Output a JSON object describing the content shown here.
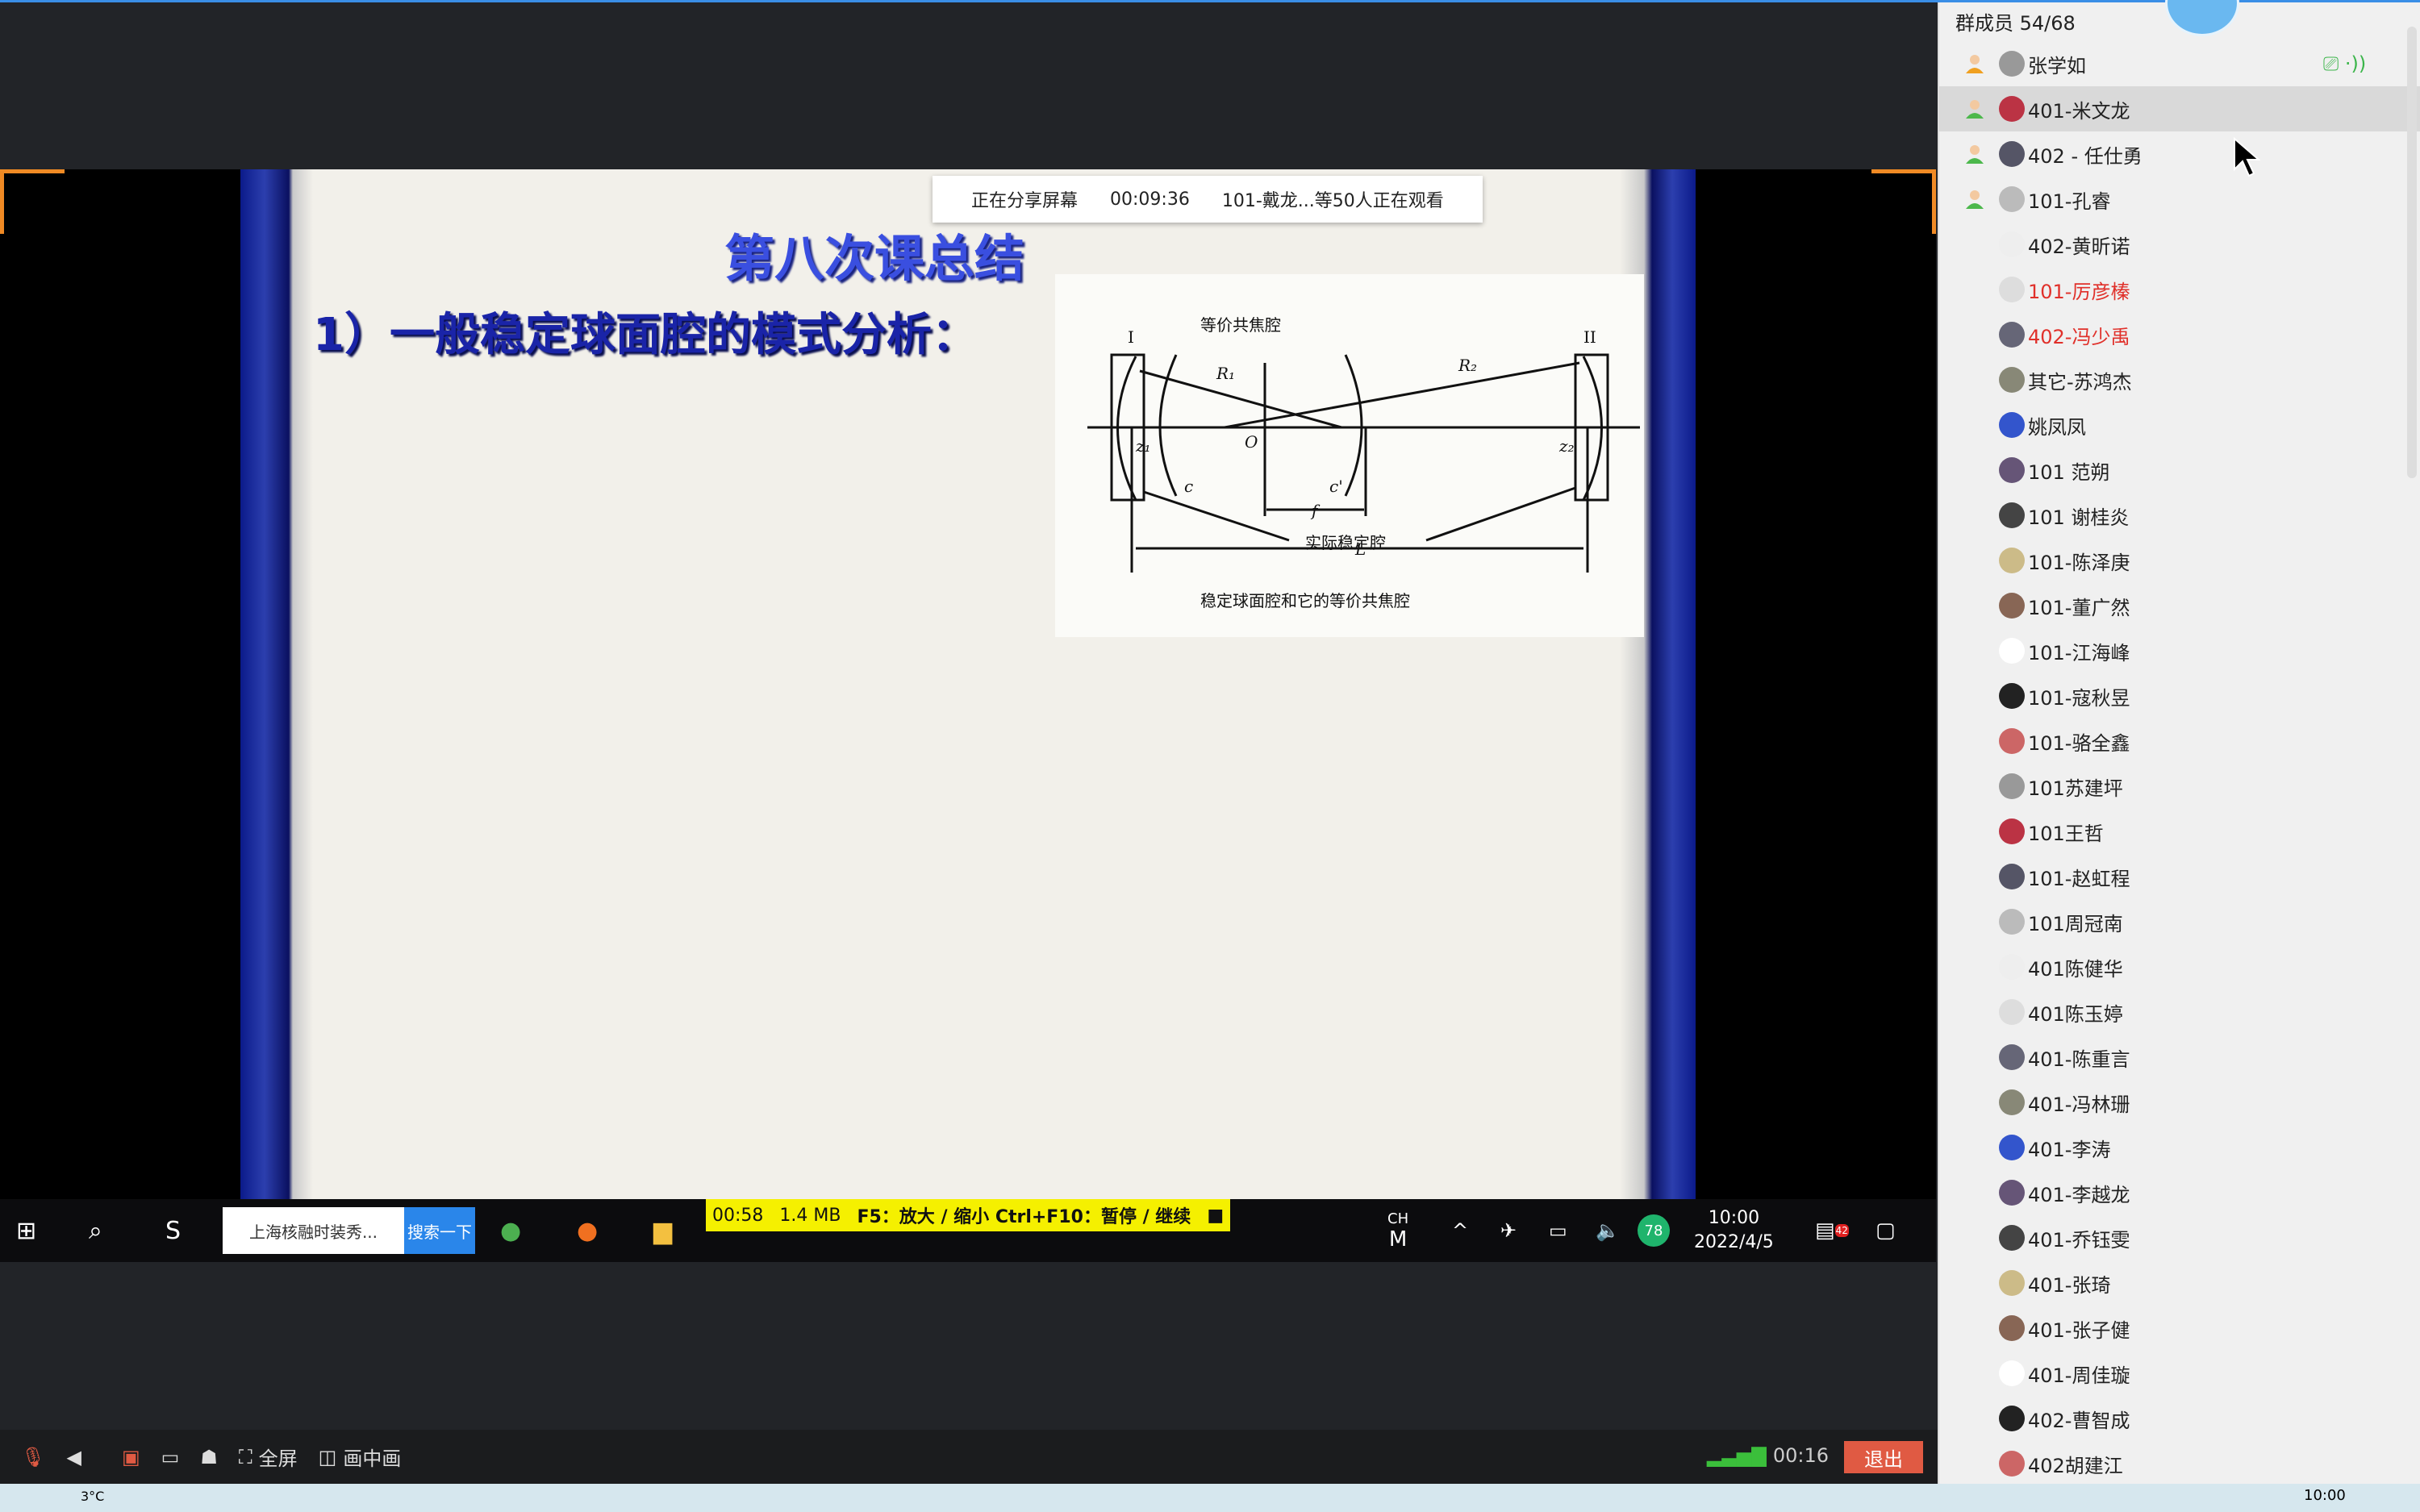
{
  "share_banner": {
    "status": "正在分享屏幕",
    "elapsed": "00:09:36",
    "viewers": "101-戴龙...等50人正在观看"
  },
  "slide": {
    "title": "第八次课总结",
    "subtitle": "1）一般稳定球面腔的模式分析：",
    "diagram": {
      "label_top": "等价共焦腔",
      "label_bottom": "实际稳定腔",
      "caption": "稳定球面腔和它的等价共焦腔",
      "mirror1": "I",
      "mirror2": "II",
      "r1": "R₁",
      "r2": "R₂",
      "origin": "O",
      "z1": "z₁",
      "z2": "z₂",
      "c": "c",
      "c2": "c'",
      "f": "f",
      "L": "L"
    }
  },
  "remote_taskbar": {
    "search_box": "上海核融时装秀...",
    "search_button": "搜索一下",
    "recorder": {
      "time": "00:58",
      "size": "1.4 MB",
      "hint": "F5：放大 / 缩小 Ctrl+F10：暂停 / 继续"
    },
    "ime_top": "CH",
    "ime": "M",
    "battery_badge": "78",
    "clock_time": "10:00",
    "clock_date": "2022/4/5",
    "notif_count": "42"
  },
  "toolbar": {
    "fullscreen": "全屏",
    "pip": "画中画",
    "duration": "00:16",
    "exit": "退出"
  },
  "panel": {
    "title": "群成员 54/68",
    "members": [
      {
        "name": "张学如",
        "role": "host",
        "sharing": true
      },
      {
        "name": "401-米文龙",
        "role": "admin",
        "selected": true
      },
      {
        "name": "402 - 任仕勇",
        "role": "admin"
      },
      {
        "name": "101-孔睿",
        "role": "admin"
      },
      {
        "name": "402-黄昕诺"
      },
      {
        "name": "101-厉彦榛",
        "color": "#e0302a"
      },
      {
        "name": "402-冯少禹",
        "color": "#e0302a"
      },
      {
        "name": "其它-苏鸿杰"
      },
      {
        "name": "姚凤凤"
      },
      {
        "name": "101 范朔"
      },
      {
        "name": "101 谢桂炎"
      },
      {
        "name": "101-陈泽庚"
      },
      {
        "name": "101-董广然"
      },
      {
        "name": "101-江海峰"
      },
      {
        "name": "101-寇秋昱"
      },
      {
        "name": "101-骆全鑫"
      },
      {
        "name": "101苏建坪"
      },
      {
        "name": "101王哲"
      },
      {
        "name": "101-赵虹程"
      },
      {
        "name": "101周冠南"
      },
      {
        "name": "401陈健华"
      },
      {
        "name": "401陈玉婷"
      },
      {
        "name": "401-陈重言"
      },
      {
        "name": "401-冯林珊"
      },
      {
        "name": "401-李涛"
      },
      {
        "name": "401-李越龙"
      },
      {
        "name": "401-乔钰雯"
      },
      {
        "name": "401-张琦"
      },
      {
        "name": "401-张子健"
      },
      {
        "name": "401-周佳璇"
      },
      {
        "name": "402-曹智成"
      },
      {
        "name": "402胡建江"
      }
    ]
  },
  "system_taskbar": {
    "weather": "3°C",
    "clock": "10:00"
  }
}
